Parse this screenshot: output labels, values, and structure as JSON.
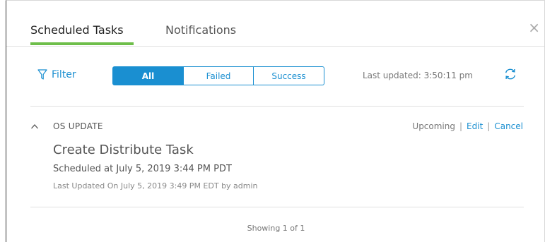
{
  "tabs": {
    "scheduled_label": "Scheduled Tasks",
    "notifications_label": "Notifications",
    "close_glyph": "×"
  },
  "toolbar": {
    "filter_label": "Filter",
    "segments": [
      "All",
      "Failed",
      "Success"
    ],
    "active_segment": "All",
    "last_updated": "Last updated: 3:50:11 pm"
  },
  "task": {
    "category": "OS UPDATE",
    "status": "Upcoming",
    "separator": "|",
    "edit_label": "Edit",
    "cancel_label": "Cancel",
    "name": "Create Distribute Task",
    "scheduled_at": "Scheduled at July 5, 2019 3:44 PM PDT",
    "last_updated_on": "Last Updated On July 5, 2019 3:49 PM EDT by admin"
  },
  "footer": {
    "showing": "Showing 1 of 1"
  },
  "colors": {
    "accent": "#1a8fd1",
    "tab_underline": "#6ebe4a"
  }
}
